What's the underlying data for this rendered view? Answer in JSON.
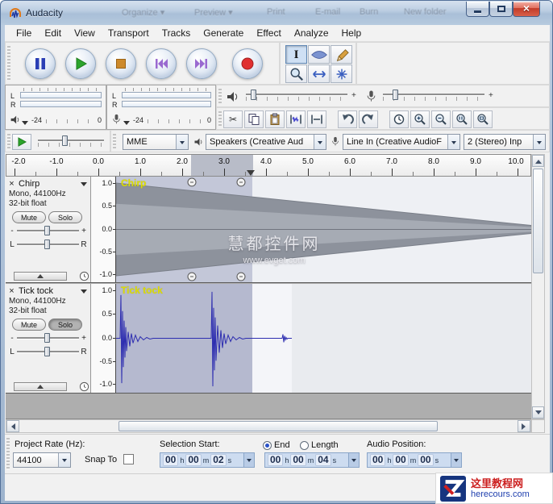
{
  "window": {
    "title": "Audacity",
    "ghost_toolbar": [
      "Organize ▾",
      "Preview ▾",
      "Print",
      "E-mail",
      "Burn",
      "New folder"
    ]
  },
  "menu": {
    "items": [
      "File",
      "Edit",
      "View",
      "Transport",
      "Tracks",
      "Generate",
      "Effect",
      "Analyze",
      "Help"
    ]
  },
  "timeline": {
    "ticks": [
      "-2.0",
      "-1.0",
      "0.0",
      "1.0",
      "2.0",
      "3.0",
      "4.0",
      "5.0",
      "6.0",
      "7.0",
      "8.0",
      "9.0",
      "10.0"
    ]
  },
  "meters": {
    "playback": {
      "l": "L",
      "r": "R",
      "min": "-24",
      "max": "0"
    },
    "recording": {
      "l": "L",
      "r": "R",
      "min": "-24",
      "max": "0"
    }
  },
  "mixer": {
    "output_plus": "+",
    "input_plus": "+"
  },
  "devices": {
    "host": "MME",
    "output": "Speakers (Creative Aud",
    "input": "Line In (Creative AudioF",
    "channels": "2 (Stereo) Inp"
  },
  "tracks": [
    {
      "name": "Chirp",
      "clip_label": "Chirp",
      "format": "Mono, 44100Hz",
      "depth": "32-bit float",
      "mute": "Mute",
      "solo": "Solo",
      "gain_min": "-",
      "gain_max": "+",
      "pan_l": "L",
      "pan_r": "R",
      "scale": [
        "1.0",
        "0.5",
        "0.0",
        "-0.5",
        "-1.0"
      ]
    },
    {
      "name": "Tick tock",
      "clip_label": "Tick tock",
      "format": "Mono, 44100Hz",
      "depth": "32-bit float",
      "mute": "Mute",
      "solo": "Solo",
      "gain_min": "-",
      "gain_max": "+",
      "pan_l": "L",
      "pan_r": "R",
      "scale": [
        "1.0",
        "0.5",
        "0.0",
        "-0.5",
        "-1.0"
      ]
    }
  ],
  "selection_bar": {
    "project_rate_label": "Project Rate (Hz):",
    "project_rate": "44100",
    "snap_label": "Snap To",
    "selection_start_label": "Selection Start:",
    "end_label": "End",
    "length_label": "Length",
    "audio_position_label": "Audio Position:",
    "selection_start_parts": [
      "00",
      "h",
      "00",
      "m",
      "02",
      "s"
    ],
    "selection_end_parts": [
      "00",
      "h",
      "00",
      "m",
      "04",
      "s"
    ],
    "audio_position_parts": [
      "00",
      "h",
      "00",
      "m",
      "00",
      "s"
    ]
  },
  "watermark": {
    "line1": "慧都控件网",
    "line2": "www.evget.com"
  },
  "badge": {
    "line1": "这里教程网",
    "line2": "herecours.com"
  },
  "icons": {
    "audacity-logo-icon": "headphones with blue wave",
    "pause-icon": "two blue bars",
    "play-icon": "green triangle",
    "stop-icon": "orange square",
    "skip-start-icon": "purple double triangle left",
    "skip-end-icon": "purple double triangle right",
    "record-icon": "red circle",
    "selection-tool-icon": "I-beam",
    "envelope-tool-icon": "blue lens",
    "draw-tool-icon": "pencil",
    "zoom-tool-icon": "magnifier",
    "timeshift-tool-icon": "double arrow",
    "multi-tool-icon": "star",
    "speaker-icon": "speaker",
    "microphone-icon": "microphone",
    "cut-icon": "scissors",
    "copy-icon": "two pages",
    "paste-icon": "clipboard",
    "trim-icon": "wave between brackets",
    "silence-icon": "flat line between brackets",
    "undo-icon": "curved arrow left",
    "redo-icon": "curved arrow right",
    "synclock-icon": "clock",
    "zoomin-icon": "magnifier plus",
    "zoomout-icon": "magnifier minus",
    "fitselection-icon": "magnifier with bars",
    "fitproject-icon": "magnifier with rect"
  }
}
